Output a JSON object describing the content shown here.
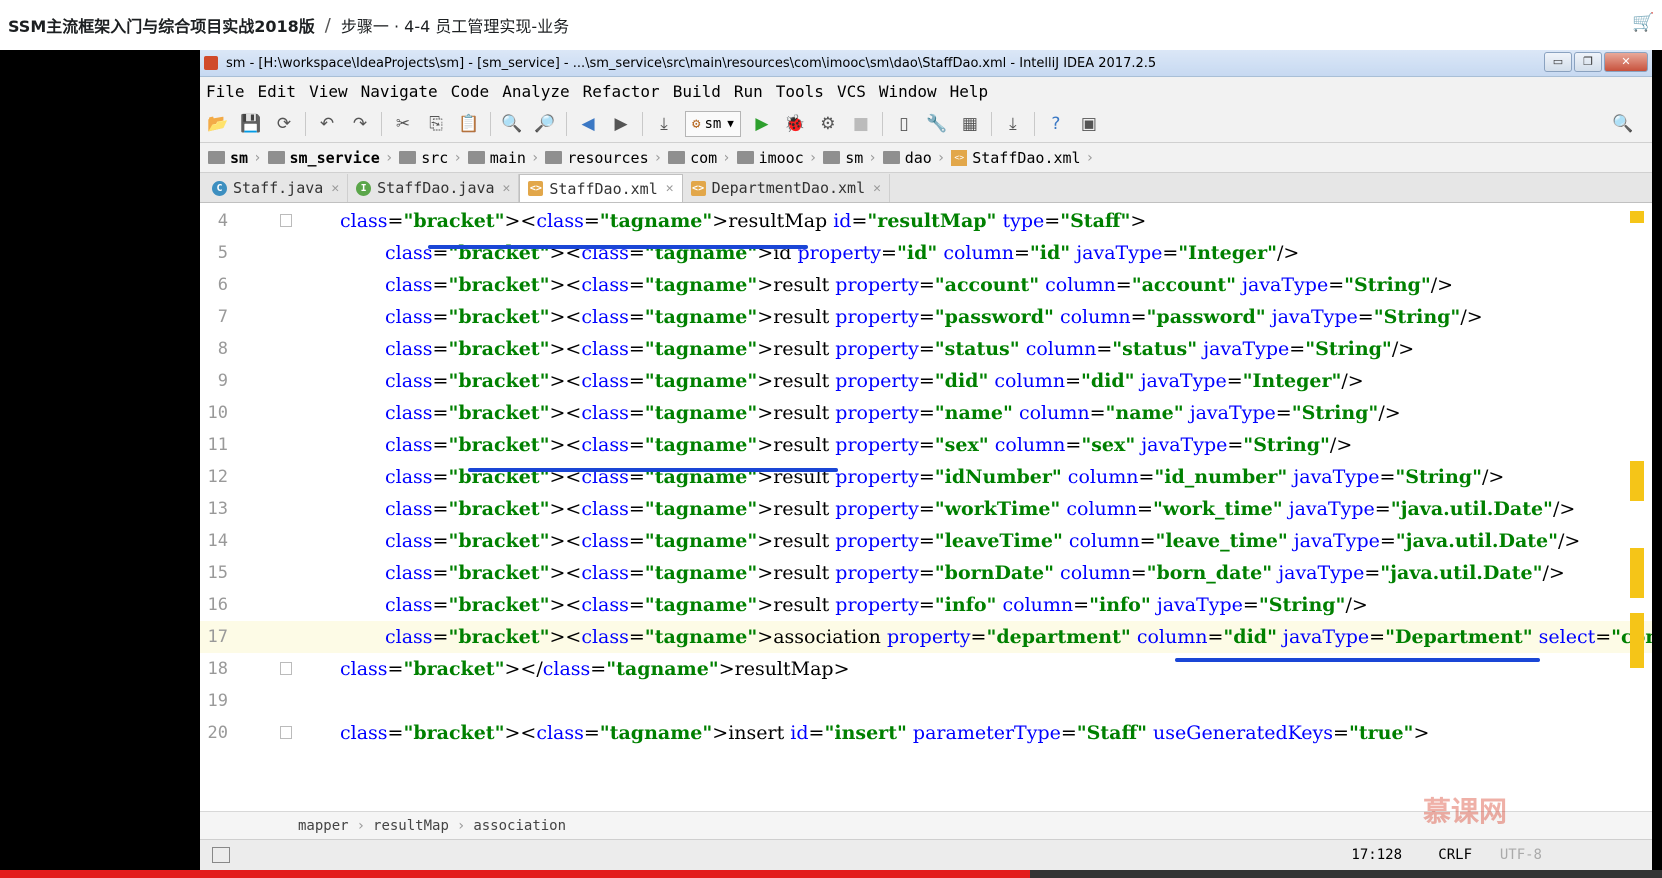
{
  "course": {
    "title": "SSM主流框架入门与综合项目实战2018版",
    "separator": "/",
    "step": "步骤一 · 4-4 员工管理实现-业务"
  },
  "window": {
    "title": "sm - [H:\\workspace\\IdeaProjects\\sm] - [sm_service] - ...\\sm_service\\src\\main\\resources\\com\\imooc\\sm\\dao\\StaffDao.xml - IntelliJ IDEA 2017.2.5",
    "controls": [
      "▭",
      "❐",
      "✕"
    ]
  },
  "menu": [
    "File",
    "Edit",
    "View",
    "Navigate",
    "Code",
    "Analyze",
    "Refactor",
    "Build",
    "Run",
    "Tools",
    "VCS",
    "Window",
    "Help"
  ],
  "toolbar": {
    "run_config": "sm"
  },
  "breadcrumbs": [
    "sm",
    "sm_service",
    "src",
    "main",
    "resources",
    "com",
    "imooc",
    "sm",
    "dao",
    "StaffDao.xml"
  ],
  "tabs": [
    {
      "label": "Staff.java",
      "kind": "class"
    },
    {
      "label": "StaffDao.java",
      "kind": "interface"
    },
    {
      "label": "StaffDao.xml",
      "kind": "xml"
    },
    {
      "label": "DepartmentDao.xml",
      "kind": "xml"
    }
  ],
  "code": {
    "lines": [
      {
        "n": "4",
        "text": "<resultMap id=\"resultMap\" type=\"Staff\">"
      },
      {
        "n": "5",
        "text": "<id property=\"id\" column=\"id\" javaType=\"Integer\"/>"
      },
      {
        "n": "6",
        "text": "<result property=\"account\" column=\"account\" javaType=\"String\"/>"
      },
      {
        "n": "7",
        "text": "<result property=\"password\" column=\"password\" javaType=\"String\"/>"
      },
      {
        "n": "8",
        "text": "<result property=\"status\" column=\"status\" javaType=\"String\"/>"
      },
      {
        "n": "9",
        "text": "<result property=\"did\" column=\"did\" javaType=\"Integer\"/>"
      },
      {
        "n": "10",
        "text": "<result property=\"name\" column=\"name\" javaType=\"String\"/>"
      },
      {
        "n": "11",
        "text": "<result property=\"sex\" column=\"sex\" javaType=\"String\"/>"
      },
      {
        "n": "12",
        "text": "<result property=\"idNumber\" column=\"id_number\" javaType=\"String\"/>"
      },
      {
        "n": "13",
        "text": "<result property=\"workTime\" column=\"work_time\" javaType=\"java.util.Date\"/>"
      },
      {
        "n": "14",
        "text": "<result property=\"leaveTime\" column=\"leave_time\" javaType=\"java.util.Date\"/>"
      },
      {
        "n": "15",
        "text": "<result property=\"bornDate\" column=\"born_date\" javaType=\"java.util.Date\"/>"
      },
      {
        "n": "16",
        "text": "<result property=\"info\" column=\"info\" javaType=\"String\"/>"
      },
      {
        "n": "17",
        "text": "<association property=\"department\" column=\"did\" javaType=\"Department\" select=\"com.imooc.sm.dao.Depart"
      },
      {
        "n": "18",
        "text": "</resultMap>"
      },
      {
        "n": "19",
        "text": ""
      },
      {
        "n": "20",
        "text": "<insert id=\"insert\" parameterType=\"Staff\" useGeneratedKeys=\"true\">"
      }
    ]
  },
  "structure_path": [
    "mapper",
    "resultMap",
    "association"
  ],
  "status": {
    "position": "17:128",
    "line_sep": "CRLF",
    "encoding": "UTF-8"
  },
  "watermark": "慕课网",
  "video_progress": 0.62
}
